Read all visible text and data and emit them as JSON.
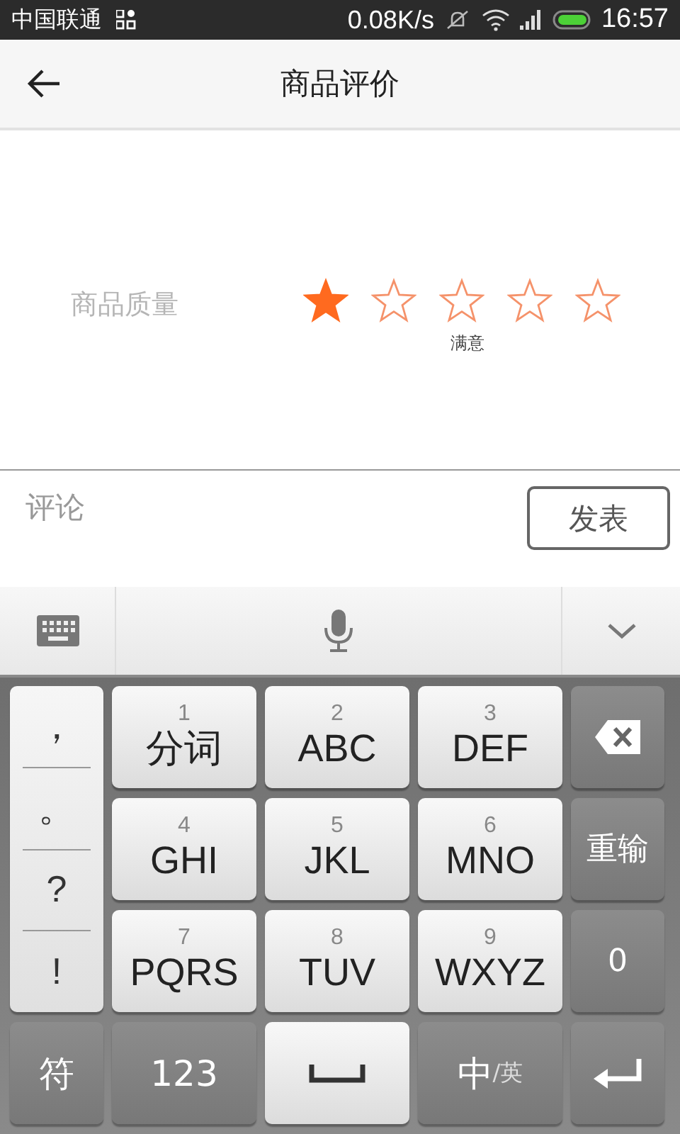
{
  "status_bar": {
    "carrier": "中国联通",
    "speed": "0.08K/s",
    "time": "16:57"
  },
  "header": {
    "title": "商品评价"
  },
  "rating": {
    "label": "商品质量",
    "stars": 1,
    "caption": "满意"
  },
  "comment": {
    "placeholder": "评论",
    "button": "发表"
  },
  "keyboard": {
    "punctuation": [
      "，",
      "。",
      "?",
      "!"
    ],
    "keys": [
      {
        "digit": "1",
        "label": "分词"
      },
      {
        "digit": "2",
        "label": "ABC"
      },
      {
        "digit": "3",
        "label": "DEF"
      },
      {
        "digit": "4",
        "label": "GHI"
      },
      {
        "digit": "5",
        "label": "JKL"
      },
      {
        "digit": "6",
        "label": "MNO"
      },
      {
        "digit": "7",
        "label": "PQRS"
      },
      {
        "digit": "8",
        "label": "TUV"
      },
      {
        "digit": "9",
        "label": "WXYZ"
      }
    ],
    "side_keys": [
      {
        "kind": "delete"
      },
      {
        "kind": "text",
        "label": "重输"
      },
      {
        "kind": "text",
        "label": "0"
      }
    ],
    "bottom_keys": [
      {
        "kind": "text",
        "label": "符"
      },
      {
        "kind": "text",
        "label": "123"
      },
      {
        "kind": "space"
      },
      {
        "kind": "lang",
        "label": "中",
        "sub": "/英"
      },
      {
        "kind": "enter"
      }
    ]
  }
}
